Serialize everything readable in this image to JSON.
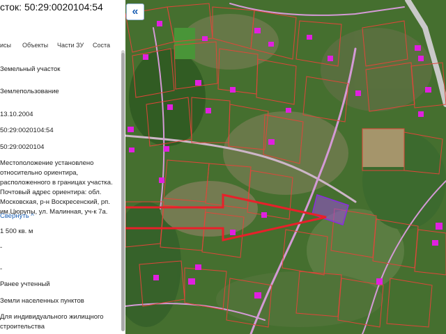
{
  "panel": {
    "title": "сток: 50:29:0020104:54",
    "tabs": [
      "исы",
      "Объекты",
      "Части ЗУ",
      "Соста"
    ],
    "fields": {
      "type": "Земельный участок",
      "kind": "Землепользование",
      "date": "13.10.2004",
      "cadnum": "50:29:0020104:54",
      "quarter": "50:29:0020104",
      "address": "Местоположение установлено относительно ориентира, расположенного в границах участка. Почтовый адрес ориентира: обл. Московская, р-н Воскресенский, рп. им.Цюрупы, ул. Малинная, уч-к 7а.",
      "collapse": "Свернуть ^",
      "area": "1 500 кв. м",
      "dash1": "-",
      "dash2": "-",
      "status": "Ранее учтенный",
      "category": "Земли населенных пунктов",
      "use": "Для индивидуального жилищного строительства"
    }
  },
  "map": {
    "collapse_button": "«",
    "colors": {
      "boundary": "#e0463a",
      "building": "#e020e0",
      "arrow": "#e8202a",
      "parcel": "#9b4fd8",
      "road": "#d49ad6"
    }
  }
}
